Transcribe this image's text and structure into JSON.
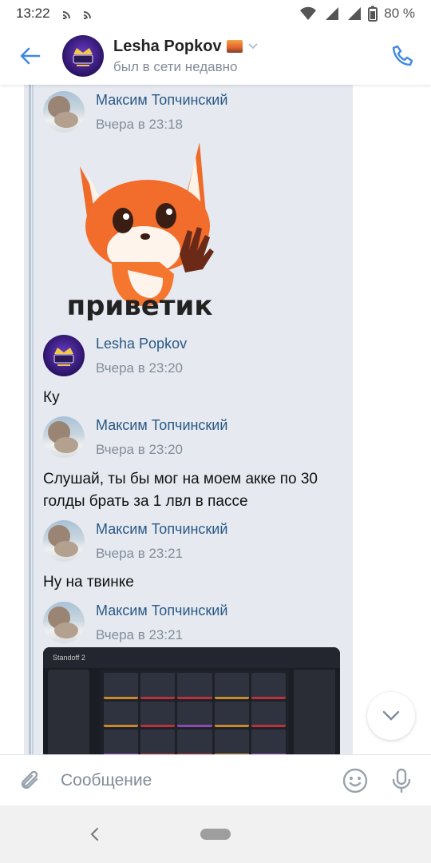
{
  "status_bar": {
    "time": "13:22",
    "battery": "80 %"
  },
  "header": {
    "name": "Lesha Popkov",
    "status": "был в сети недавно"
  },
  "messages": [
    {
      "author": "Максим Топчинский",
      "time": "Вчера в 23:18",
      "sticker_caption": "приветик"
    },
    {
      "author": "Lesha Popkov",
      "time": "Вчера в 23:20",
      "text": "Ку"
    },
    {
      "author": "Максим Топчинский",
      "time": "Вчера в 23:20",
      "text": "Слушай, ты бы мог на моем акке по 30 голды брать за 1 лвл в пассе"
    },
    {
      "author": "Максим Топчинский",
      "time": "Вчера в 23:21",
      "text": "Ну на твинке"
    },
    {
      "author": "Максим Топчинский",
      "time": "Вчера в 23:21",
      "attachment": "screenshot",
      "attachment_title": "Standoff 2"
    }
  ],
  "composer": {
    "placeholder": "Сообщение"
  },
  "colors": {
    "accent": "#3f8ae0",
    "author": "#2a5885",
    "secondary_text": "#818c99",
    "bubble": "#e6eaf0"
  },
  "icons": {
    "back": "arrow-left-icon",
    "call": "phone-icon",
    "attach": "paperclip-icon",
    "emoji": "smile-icon",
    "mic": "microphone-icon",
    "scroll": "chevron-down-icon"
  }
}
